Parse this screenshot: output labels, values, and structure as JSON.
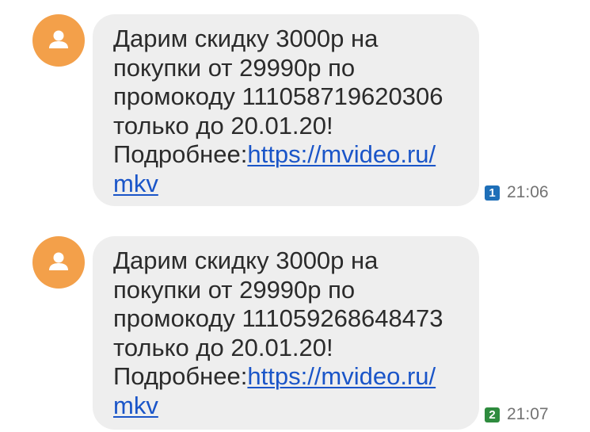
{
  "messages": [
    {
      "lines": [
        "Дарим скидку 3000р на",
        "покупки от 29990р по",
        "промокоду 111058719620306",
        "только до 20.01.20!"
      ],
      "more_prefix": "Подробнее:",
      "link_part1": "https://mvideo.ru/",
      "link_part2": "mkv",
      "sim": "1",
      "sim_color": "#1e6fb8",
      "time": "21:06",
      "avatar_icon": "person-icon",
      "avatar_color": "#f3a04a"
    },
    {
      "lines": [
        "Дарим скидку 3000р на",
        "покупки от 29990р по",
        "промокоду 111059268648473",
        "только до 20.01.20!"
      ],
      "more_prefix": "Подробнее:",
      "link_part1": "https://mvideo.ru/",
      "link_part2": "mkv",
      "sim": "2",
      "sim_color": "#2e8b3e",
      "time": "21:07",
      "avatar_icon": "person-icon",
      "avatar_color": "#f3a04a"
    }
  ],
  "colors": {
    "bubble_bg": "#eeeeee",
    "link": "#1a55c8",
    "text": "#2b2b2b",
    "time": "#737373"
  }
}
